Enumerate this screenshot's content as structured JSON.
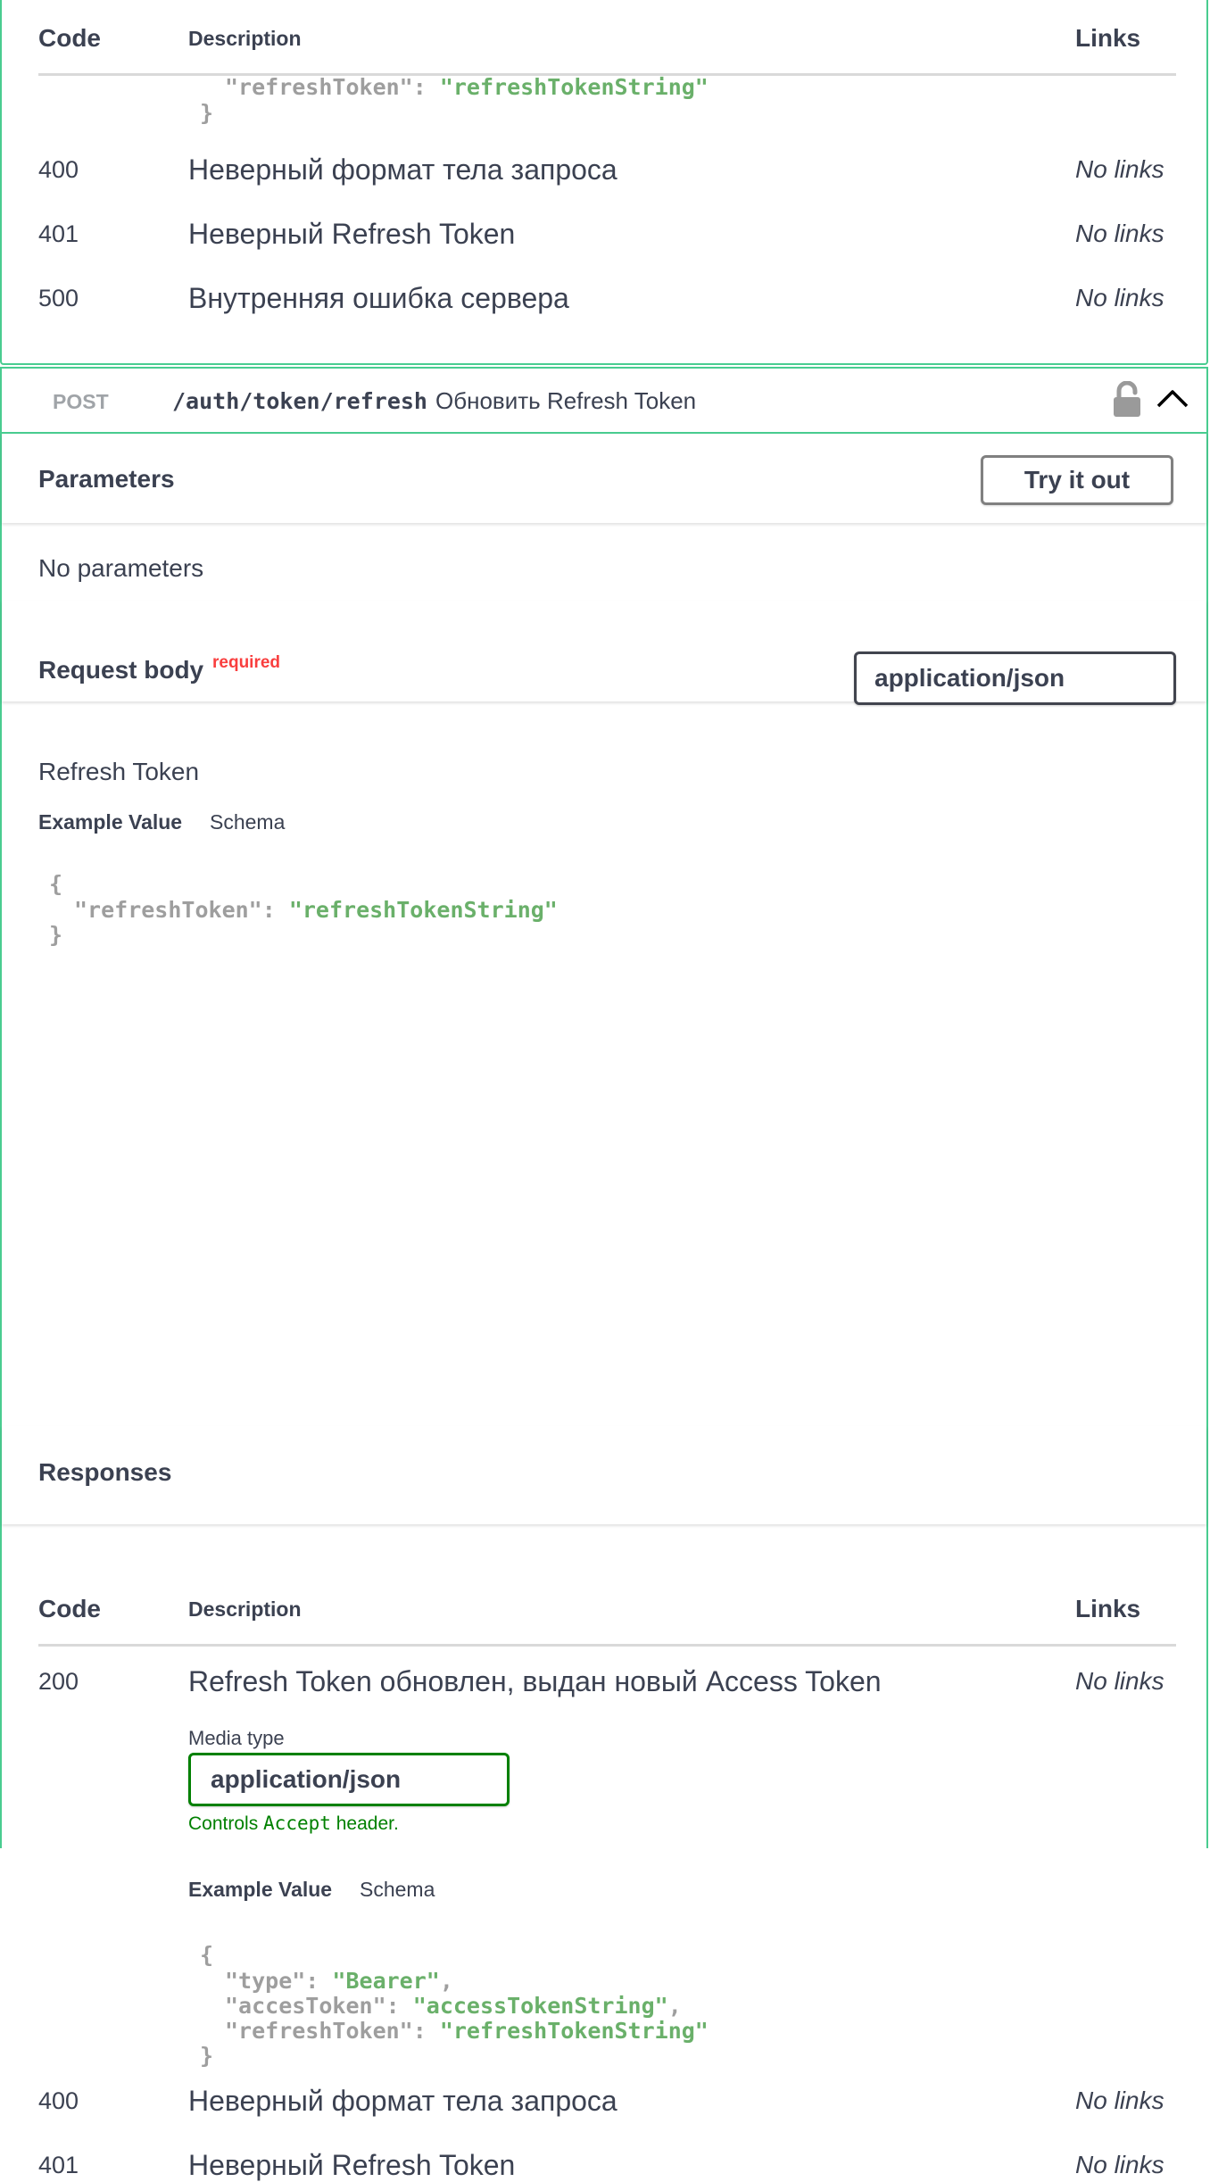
{
  "colors": {
    "post_accent": "#49cc90",
    "required": "#f93e3e",
    "json_string": "#6ab06a",
    "json_key": "#9e9e9e",
    "controls_green": "#008000"
  },
  "top_table": {
    "headers": {
      "code": "Code",
      "description": "Description",
      "links": "Links"
    },
    "json_tail": [
      "\"refreshToken\": ",
      "\"refreshTokenString\"",
      "}"
    ],
    "rows": [
      {
        "code": "400",
        "description": "Неверный формат тела запроса",
        "links": "No links"
      },
      {
        "code": "401",
        "description": "Неверный Refresh Token",
        "links": "No links"
      },
      {
        "code": "500",
        "description": "Внутренняя ошибка сервера",
        "links": "No links"
      }
    ]
  },
  "operation": {
    "method": "POST",
    "path": "/auth/token/refresh",
    "summary": "Обновить Refresh Token",
    "lock_icon": "lock-open-icon",
    "collapse_icon": "chevron-up-icon"
  },
  "parameters": {
    "title": "Parameters",
    "try_button": "Try it out",
    "empty_text": "No parameters"
  },
  "request_body": {
    "title": "Request body",
    "required_label": "required",
    "content_type": "application/json",
    "description": "Refresh Token",
    "tab_example": "Example Value",
    "tab_schema": "Schema",
    "example": {
      "open": "{",
      "key": "\"refreshToken\": ",
      "value": "\"refreshTokenString\"",
      "close": "}"
    }
  },
  "responses": {
    "title": "Responses",
    "headers": {
      "code": "Code",
      "description": "Description",
      "links": "Links"
    },
    "row_200": {
      "code": "200",
      "description": "Refresh Token обновлен, выдан новый Access Token",
      "links": "No links",
      "media_type_label": "Media type",
      "media_type": "application/json",
      "controls_prefix": "Controls ",
      "controls_code": "Accept",
      "controls_suffix": " header.",
      "tab_example": "Example Value",
      "tab_schema": "Schema",
      "example": {
        "open": "{",
        "k1": "\"type\": ",
        "v1": "\"Bearer\"",
        "k2": "\"accesToken\": ",
        "v2": "\"accessTokenString\"",
        "k3": "\"refreshToken\": ",
        "v3": "\"refreshTokenString\"",
        "comma": ",",
        "close": "}"
      }
    },
    "rows": [
      {
        "code": "400",
        "description": "Неверный формат тела запроса",
        "links": "No links"
      },
      {
        "code": "401",
        "description": "Неверный Refresh Token",
        "links": "No links"
      }
    ]
  }
}
